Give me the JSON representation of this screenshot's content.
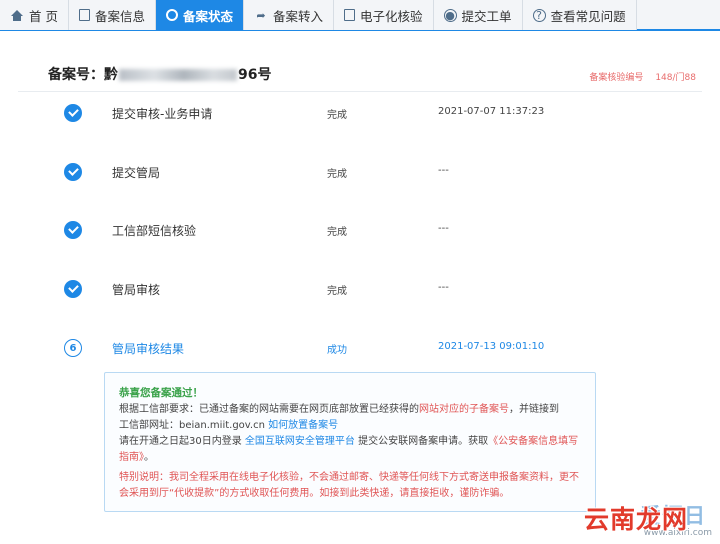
{
  "tabs": [
    {
      "label": "首 页",
      "icon": "home-icon"
    },
    {
      "label": "备案信息",
      "icon": "document-icon"
    },
    {
      "label": "备案状态",
      "icon": "status-circle-icon"
    },
    {
      "label": "备案转入",
      "icon": "arrow-right-icon"
    },
    {
      "label": "电子化核验",
      "icon": "clipboard-icon"
    },
    {
      "label": "提交工单",
      "icon": "user-icon"
    },
    {
      "label": "查看常见问题",
      "icon": "question-icon"
    }
  ],
  "active_tab": "备案状态",
  "record": {
    "prefix": "备案号：黔",
    "suffix": "96号",
    "right_label": "备案核验编号",
    "right_value": "148/门88"
  },
  "steps": [
    {
      "name": "提交审核-业务申请",
      "status": "完成",
      "time": "2021-07-07 11:37:23"
    },
    {
      "name": "提交管局",
      "status": "完成",
      "time": "---"
    },
    {
      "name": "工信部短信核验",
      "status": "完成",
      "time": "---"
    },
    {
      "name": "管局审核",
      "status": "完成",
      "time": "---"
    },
    {
      "number": "6",
      "name": "管局审核结果",
      "status": "成功",
      "time": "2021-07-13 09:01:10"
    }
  ],
  "notice": {
    "title": "恭喜您备案通过！",
    "line1_a": "根据工信部要求：已通过备案的网站需要在网页底部放置已经获得的",
    "line1_red": "网站对应的子备案号",
    "line1_b": "，并链接到",
    "line2_a": "工信部网址：beian.miit.gov.cn ",
    "line2_link": "如何放置备案号",
    "line3_a": "请在开通之日起30日内登录 ",
    "line3_link": "全国互联网安全管理平台",
    "line3_b": " 提交公安联网备案申请。获取",
    "line3_red": "《公安备案信息填写指南》",
    "line3_c": "。",
    "special": "特别说明：我司全程采用在线电子化核验，不会通过邮寄、快递等任何线下方式寄送申报备案资料，更不会采用到厅“代收提款”的方式收取任何费用。如接到此类快递，请直接拒收，谨防诈骗。"
  },
  "watermark": {
    "blue": "爱悟日",
    "url": "www.aixiri.com",
    "red": "云南龙网"
  }
}
